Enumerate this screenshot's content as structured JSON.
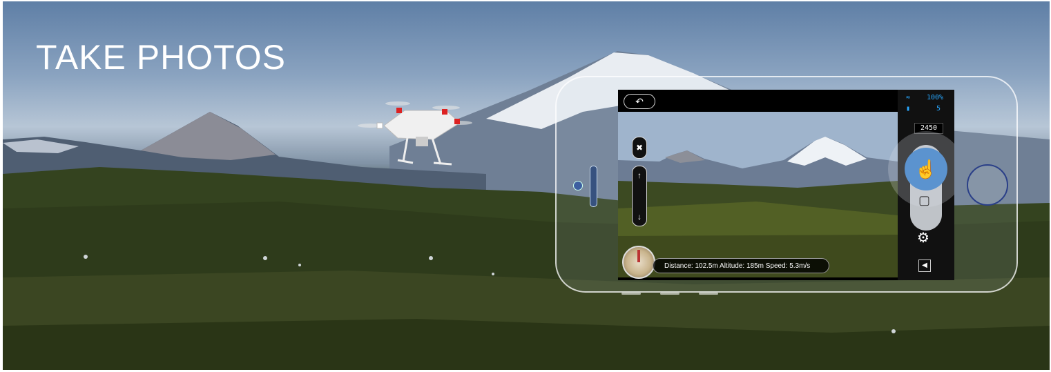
{
  "banner": {
    "headline": "TAKE PHOTOS"
  },
  "app": {
    "topbar": {
      "back_icon": "back-arrow-icon"
    },
    "status": {
      "signal_icon": "wifi-icon",
      "battery_text": "100%",
      "gps_text": "5"
    },
    "counter": "2450",
    "controls": {
      "shutter_icon": "touch-shutter-icon",
      "video_icon": "video-camera-icon",
      "settings_icon": "gear-icon",
      "collapse_icon": "collapse-icon",
      "camera_toggle_icon": "camera-toggle-icon",
      "up_icon": "up-arrow-icon",
      "down_icon": "down-arrow-icon"
    },
    "telemetry": {
      "text": "Distance: 102.5m  Altitude: 185m  Speed: 5.3m/s"
    }
  },
  "colors": {
    "accent": "#5b93cf",
    "status_blue": "#28a8ff"
  }
}
